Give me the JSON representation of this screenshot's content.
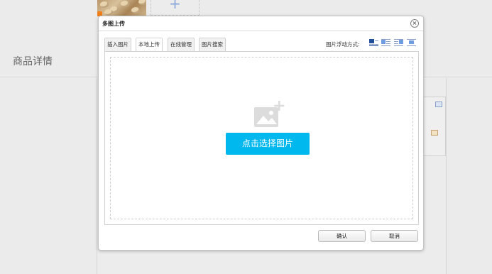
{
  "background": {
    "add_symbol": "+",
    "section_label": "商品详情"
  },
  "dialog": {
    "title": "多图上传",
    "close_symbol": "×",
    "tabs": [
      {
        "label": "插入图片",
        "active": false
      },
      {
        "label": "本地上传",
        "active": true
      },
      {
        "label": "在线管理",
        "active": false
      },
      {
        "label": "图片搜索",
        "active": false
      }
    ],
    "align_label": "图片浮动方式:",
    "align_options": [
      "none-icon",
      "left-icon",
      "right-icon",
      "center-icon"
    ],
    "choose_button": "点击选择图片",
    "confirm_button": "确认",
    "cancel_button": "取消"
  },
  "colors": {
    "accent": "#00b7ee",
    "thumb_badge": "#f07f19"
  }
}
